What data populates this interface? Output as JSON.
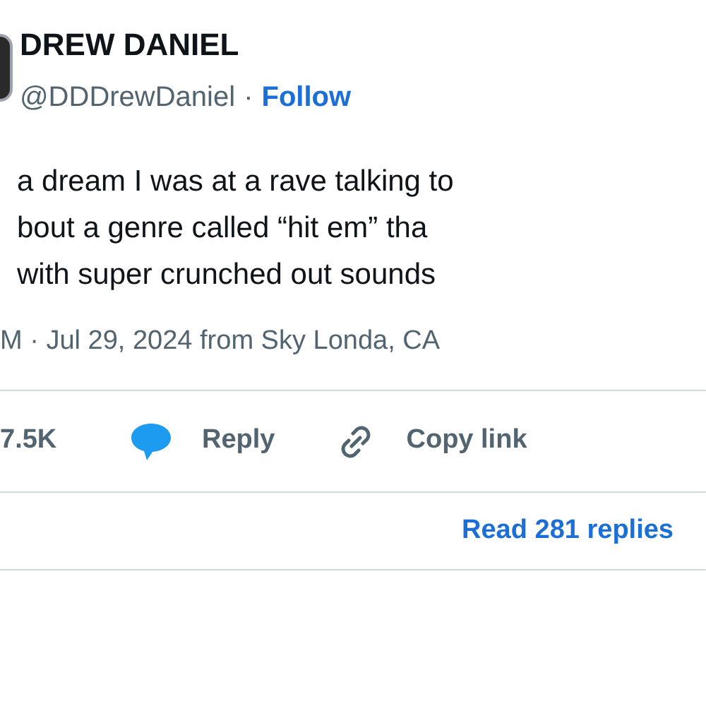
{
  "author": {
    "name": "DREW DANIEL",
    "handle": "@DDDrewDaniel",
    "separator": "·",
    "follow": "Follow"
  },
  "text_lines": [
    "a dream I was at a rave talking to",
    "bout a genre called “hit em” tha",
    "with super crunched out sounds"
  ],
  "timestamp": "M · Jul 29, 2024 from Sky Londa, CA",
  "actions": {
    "likes": "7.5K",
    "reply": "Reply",
    "copy_link": "Copy link"
  },
  "read_replies": "Read 281 replies"
}
